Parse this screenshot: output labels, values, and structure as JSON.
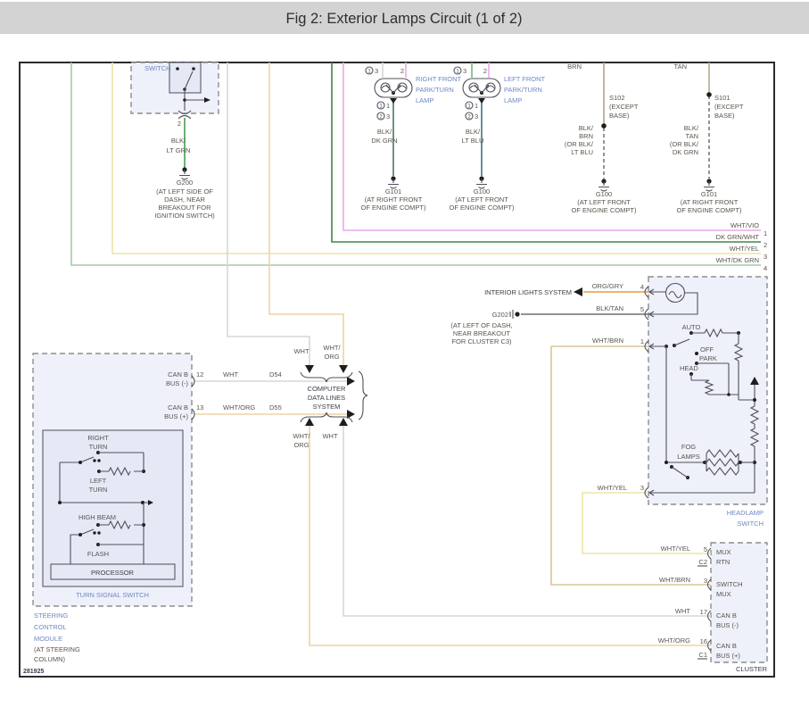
{
  "title_bar": {
    "title": "Fig 2: Exterior Lamps Circuit (1 of 2)"
  },
  "footer": {
    "figure_number": "281925"
  },
  "colors": {
    "titlebar_bg": "#d3d3d3",
    "canvas_border": "#2a2a2a",
    "module_fill": "#eef0fa",
    "label_blue": "#6e87c4",
    "wht_vio": "#eaa9ea",
    "dk_grn_wht": "#3c8a42",
    "wht_yel": "#ece5a4",
    "wht_dk_grn": "#a3cba4",
    "blk_lt_grn": "#46a24c",
    "blk_dk_grn": "#4a7a58",
    "blk_lt_blu": "#3f7580",
    "brn": "#b1a188",
    "tan": "#b8ab90",
    "org_gry": "#e99a3c",
    "blk_tan": "#6f6f6f",
    "wht_brn": "#d9c59c",
    "wht": "#d7d7d7",
    "wht_org": "#efd2a6",
    "lt_grn_stub": "#6fbe73"
  },
  "ignition": {
    "label": "SWITCH",
    "pin": "2",
    "wire": [
      "BLK/",
      "LT GRN"
    ],
    "ground": "G200",
    "location": [
      "(AT LEFT SIDE OF",
      "DASH, NEAR",
      "BREAKOUT FOR",
      "IGNITION SWITCH)"
    ]
  },
  "lamp_right": {
    "name": [
      "RIGHT FRONT",
      "PARK/TURN",
      "LAMP"
    ],
    "top_pins": {
      "c1": "1",
      "n1": "3",
      "n2": "2"
    },
    "bottom_pins": {
      "c1": "1",
      "n1": "1",
      "c2": "2",
      "n2": "3"
    },
    "wire": [
      "BLK/",
      "DK GRN"
    ],
    "ground": "G101",
    "location": [
      "(AT RIGHT FRONT",
      "OF ENGINE COMPT)"
    ]
  },
  "lamp_left": {
    "name": [
      "LEFT FRONT",
      "PARK/TURN",
      "LAMP"
    ],
    "top_pins": {
      "c1": "1",
      "n1": "3",
      "n2": "2"
    },
    "bottom_pins": {
      "c1": "1",
      "n1": "1",
      "c2": "2",
      "n2": "3"
    },
    "wire": [
      "BLK/",
      "LT BLU"
    ],
    "ground": "G100",
    "location": [
      "(AT LEFT FRONT",
      "OF ENGINE COMPT)"
    ]
  },
  "splice_left": {
    "feed": "BRN",
    "name": "S102",
    "note": [
      "(EXCEPT",
      "BASE)"
    ],
    "wire": [
      "BLK/",
      "BRN",
      "(OR BLK/",
      "LT BLU"
    ],
    "ground": "G100",
    "location": [
      "(AT LEFT FRONT",
      "OF ENGINE COMPT)"
    ]
  },
  "splice_right": {
    "feed": "TAN",
    "name": "S101",
    "note": [
      "(EXCEPT",
      "BASE)"
    ],
    "wire": [
      "BLK/",
      "TAN",
      "(OR BLK/",
      "DK GRN"
    ],
    "ground": "G101",
    "location": [
      "(AT RIGHT FRONT",
      "OF ENGINE COMPT)"
    ]
  },
  "bus": [
    {
      "label": "WHT/VIO",
      "num": "1"
    },
    {
      "label": "DK GRN/WHT",
      "num": "2"
    },
    {
      "label": "WHT/YEL",
      "num": "3"
    },
    {
      "label": "WHT/DK GRN",
      "num": "4"
    }
  ],
  "interior": {
    "label": "INTERIOR LIGHTS SYSTEM",
    "wire": "ORG/GRY",
    "pin": "4"
  },
  "g202": {
    "name": "G202",
    "location": [
      "(AT LEFT OF DASH,",
      "NEAR BREAKOUT",
      "FOR CLUSTER C3)"
    ],
    "wire": "BLK/TAN",
    "pin": "5"
  },
  "headlamp": {
    "feed_wire": "WHT/BRN",
    "feed_pin": "1",
    "positions": [
      "AUTO",
      "OFF",
      "PARK",
      "HEAD"
    ],
    "fog": [
      "FOG",
      "LAMPS"
    ],
    "out_wire": "WHT/YEL",
    "out_pin": "3",
    "name": [
      "HEADLAMP",
      "SWITCH"
    ]
  },
  "computer": {
    "rows": [
      {
        "port1": "CAN B",
        "port2": "BUS (-)",
        "pin": "12",
        "wire": "WHT",
        "term": "D54"
      },
      {
        "port1": "CAN B",
        "port2": "BUS (+)",
        "pin": "13",
        "wire": "WHT/ORG",
        "term": "D55"
      }
    ],
    "name": [
      "COMPUTER",
      "DATA LINES",
      "SYSTEM"
    ],
    "in_top": [
      "WHT",
      "WHT/",
      "ORG"
    ],
    "out_bottom": [
      "WHT/",
      "ORG",
      "WHT"
    ]
  },
  "steering": {
    "right_turn": [
      "RIGHT",
      "TURN"
    ],
    "left_turn": [
      "LEFT",
      "TURN"
    ],
    "high_beam": "HIGH BEAM",
    "flash": "FLASH",
    "processor": "PROCESSOR",
    "switch_name": "TURN SIGNAL SWITCH",
    "module_name": [
      "STEERING",
      "CONTROL",
      "MODULE"
    ],
    "module_location": [
      "(AT STEERING",
      "COLUMN)"
    ]
  },
  "cluster": {
    "rows": [
      {
        "wire": "WHT/YEL",
        "pin": "5",
        "conn": "C2",
        "port1": "MUX",
        "port2": "RTN"
      },
      {
        "wire": "WHT/BRN",
        "pin": "3",
        "port1": "SWITCH",
        "port2": "MUX"
      },
      {
        "wire": "WHT",
        "pin": "17",
        "port1": "CAN B",
        "port2": "BUS (-)"
      },
      {
        "wire": "WHT/ORG",
        "pin": "16",
        "conn": "C1",
        "port1": "CAN B",
        "port2": "BUS (+)"
      }
    ],
    "name": "CLUSTER"
  }
}
